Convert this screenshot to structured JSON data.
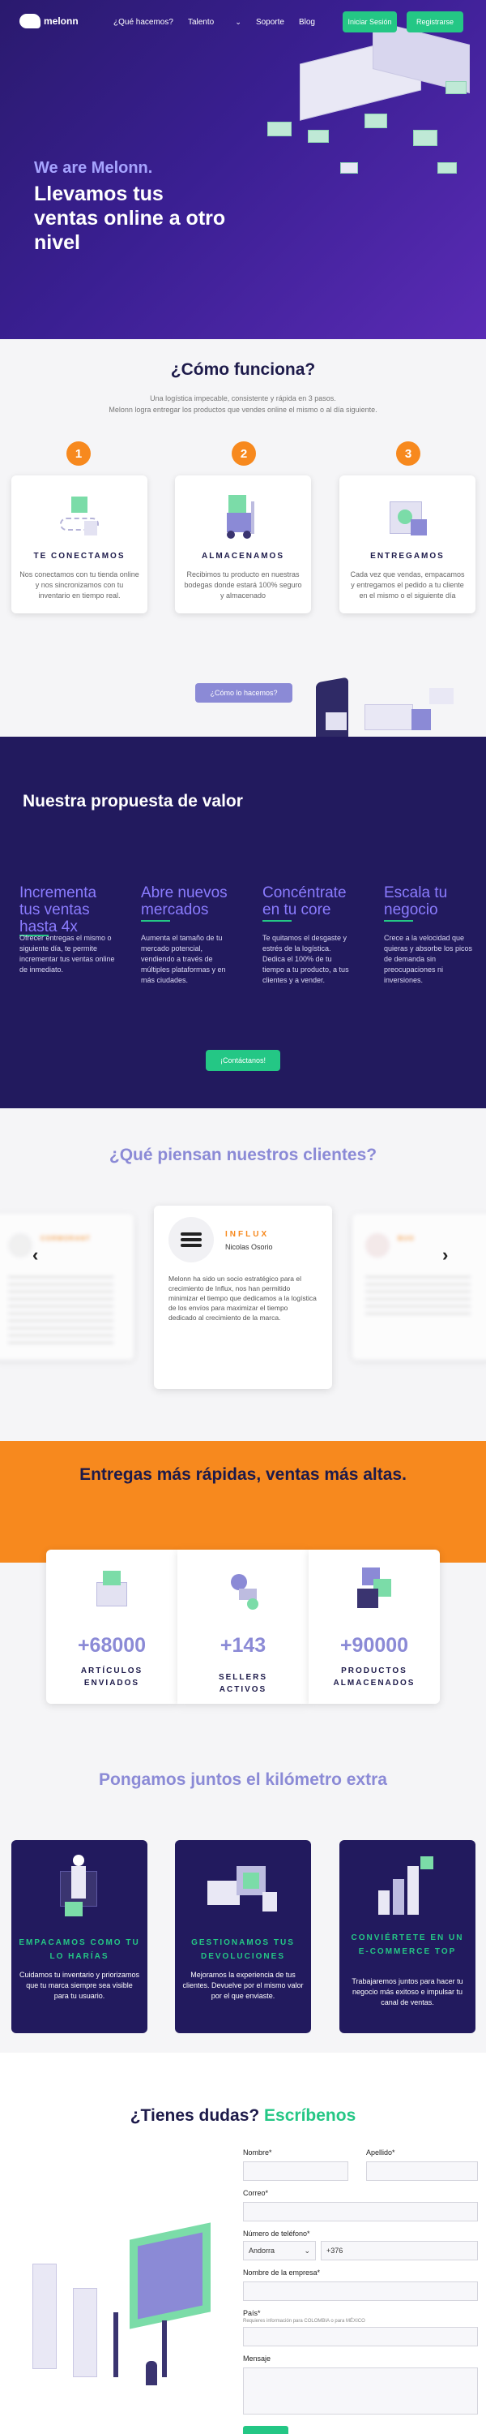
{
  "header": {
    "logo_text": "melonn",
    "nav": [
      "¿Qué hacemos?",
      "Talento",
      "Soporte",
      "Blog"
    ],
    "login_label": "Iniciar Sesión",
    "register_label": "Registrarse"
  },
  "hero": {
    "subtitle": "We are Melonn.",
    "title": "Llevamos tus ventas online a otro nivel"
  },
  "how": {
    "title": "¿Cómo funciona?",
    "intro_1": "Una logística impecable, consistente y rápida en 3 pasos.",
    "intro_2": "Melonn logra entregar los productos que vendes online el mismo o al día siguiente.",
    "steps": [
      {
        "num": "1",
        "title": "TE CONECTAMOS",
        "text": "Nos conectamos con tu tienda online y nos sincronizamos con tu inventario en tiempo real."
      },
      {
        "num": "2",
        "title": "ALMACENAMOS",
        "text": "Recibimos tu producto en nuestras bodegas donde estará 100% seguro y almacenado"
      },
      {
        "num": "3",
        "title": "ENTREGAMOS",
        "text": "Cada vez que vendas, empacamos y entregamos el pedido a tu cliente en el mismo o el siguiente día"
      }
    ],
    "cta_label": "¿Cómo lo hacemos?"
  },
  "value": {
    "title": "Nuestra propuesta de valor",
    "items": [
      {
        "title": "Incrementa tus ventas hasta 4x",
        "text": "Ofrecer entregas el mismo o siguiente día, te permite incrementar tus ventas online de inmediato."
      },
      {
        "title": "Abre nuevos mercados",
        "text": "Aumenta el tamaño de tu mercado potencial, vendiendo a través de múltiples plataformas y en más ciudades."
      },
      {
        "title": "Concéntrate en tu core",
        "text": "Te quitamos el desgaste y estrés de la logística. Dedica el 100% de tu tiempo a tu producto, a tus clientes y a vender."
      },
      {
        "title": "Escala tu negocio",
        "text": "Crece a la velocidad que quieras y absorbe los picos de demanda sin preocupaciones ni inversiones."
      }
    ],
    "cta_label": "¡Contáctanos!"
  },
  "testimonials": {
    "title": "¿Qué piensan nuestros clientes?",
    "center": {
      "brand": "INFLUX",
      "person": "Nicolas Osorio",
      "quote": "Melonn ha sido un socio estratégico para el crecimiento de Influx, nos han permitido minimizar el tiempo que dedicamos a la logística de los envíos para maximizar el tiempo dedicado al crecimiento de la marca."
    },
    "left_brand": "CORMORANT",
    "right_brand": "BUO"
  },
  "stats": {
    "title": "Entregas más rápidas, ventas más altas.",
    "items": [
      {
        "value": "+68000",
        "label": "ARTÍCULOS ENVIADOS"
      },
      {
        "value": "+143",
        "label": "SELLERS ACTIVOS"
      },
      {
        "value": "+90000",
        "label": "PRODUCTOS ALMACENADOS"
      }
    ]
  },
  "km": {
    "title": "Pongamos juntos el kilómetro extra",
    "items": [
      {
        "title": "EMPACAMOS COMO TU LO HARÍAS",
        "text": "Cuidamos tu inventario y priorizamos que tu marca siempre sea visible para tu usuario."
      },
      {
        "title": "GESTIONAMOS TUS DEVOLUCIONES",
        "text": "Mejoramos la experiencia de tus clientes. Devuelve por el mismo valor por el que enviaste."
      },
      {
        "title": "CONVIÉRTETE EN UN E-COMMERCE TOP",
        "text": "Trabajaremos juntos para hacer tu negocio más exitoso e impulsar tu canal de ventas."
      }
    ]
  },
  "form": {
    "title_a": "¿Tienes dudas?",
    "title_b": "Escríbenos",
    "name_label": "Nombre*",
    "lastname_label": "Apellido*",
    "email_label": "Correo*",
    "phone_label": "Número de teléfono*",
    "country_code_value": "Andorra",
    "phone_prefix": "+376",
    "company_label": "Nombre de la empresa*",
    "country_label": "País*",
    "country_hint": "Requieres información para COLOMBIA o para MÉXICO",
    "message_label": "Mensaje"
  },
  "colors": {
    "primary": "#2a1a6e",
    "accent_green": "#24c785",
    "accent_orange": "#f7891e",
    "accent_lilac": "#8b8ad6"
  }
}
